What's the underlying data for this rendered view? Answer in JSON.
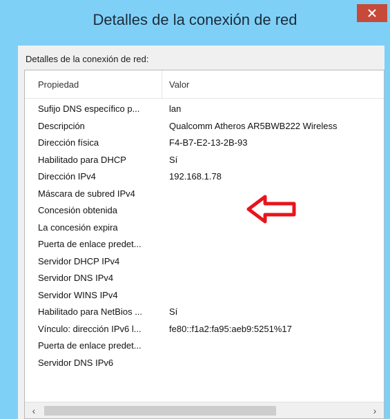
{
  "window": {
    "title": "Detalles de la conexión de red",
    "close_glyph": "×"
  },
  "group": {
    "label": "Detalles de la conexión de red:"
  },
  "table": {
    "columns": [
      "Propiedad",
      "Valor"
    ],
    "rows": [
      {
        "property": "Sufijo DNS específico p...",
        "value": "lan"
      },
      {
        "property": "Descripción",
        "value": "Qualcomm Atheros AR5BWB222 Wireless"
      },
      {
        "property": "Dirección física",
        "value": "F4-B7-E2-13-2B-93"
      },
      {
        "property": "Habilitado para DHCP",
        "value": "Sí"
      },
      {
        "property": "Dirección IPv4",
        "value": "192.168.1.78"
      },
      {
        "property": "Máscara de subred IPv4",
        "value": ""
      },
      {
        "property": "Concesión obtenida",
        "value": ""
      },
      {
        "property": "La concesión expira",
        "value": ""
      },
      {
        "property": "Puerta de enlace predet...",
        "value": ""
      },
      {
        "property": "Servidor DHCP IPv4",
        "value": ""
      },
      {
        "property": "Servidor DNS IPv4",
        "value": ""
      },
      {
        "property": "Servidor WINS IPv4",
        "value": ""
      },
      {
        "property": "Habilitado para NetBios ...",
        "value": "Sí"
      },
      {
        "property": "Vínculo: dirección IPv6 l...",
        "value": "fe80::f1a2:fa95:aeb9:5251%17"
      },
      {
        "property": "Puerta de enlace predet...",
        "value": ""
      },
      {
        "property": "Servidor DNS IPv6",
        "value": ""
      }
    ]
  },
  "annotation": {
    "arrow_color": "#e8141c",
    "points_to": "Dirección IPv4"
  },
  "scrollbar": {
    "left_glyph": "‹",
    "right_glyph": "›"
  },
  "colors": {
    "frame": "#7fd0f7",
    "close_button": "#c7493a",
    "client": "#f0f0f0"
  }
}
